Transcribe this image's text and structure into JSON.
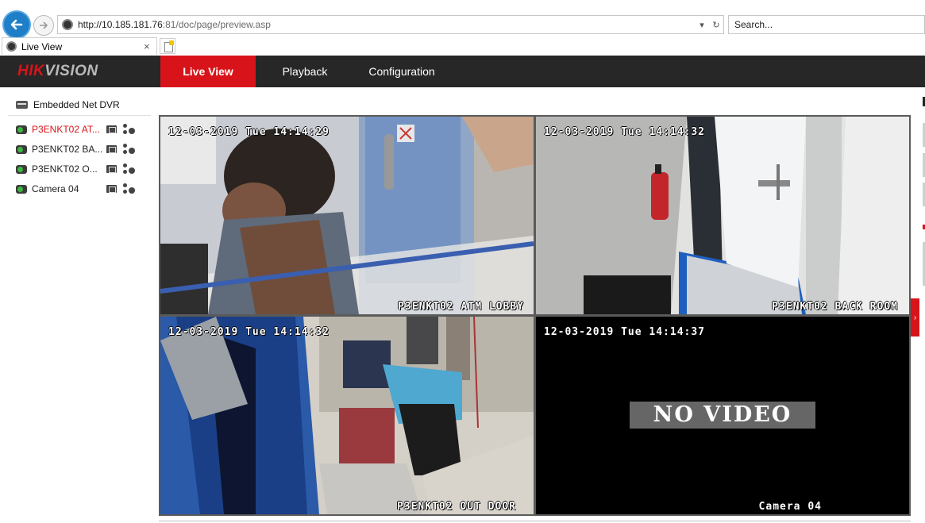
{
  "browser": {
    "url_host": "http://10.185.181.76",
    "url_rest": ":81/doc/page/preview.asp",
    "search_placeholder": "Search...",
    "tab_title": "Live View",
    "tab_close": "×",
    "dropdown_glyph": "▾",
    "refresh_glyph": "↻"
  },
  "app": {
    "logo_red": "HIK",
    "logo_rest": "VISION",
    "menu": [
      {
        "label": "Live View",
        "active": true
      },
      {
        "label": "Playback",
        "active": false
      },
      {
        "label": "Configuration",
        "active": false
      }
    ]
  },
  "sidebar": {
    "device": "Embedded Net DVR",
    "cameras": [
      {
        "label": "P3ENKT02 AT...",
        "active": true
      },
      {
        "label": "P3ENKT02 BA...",
        "active": false
      },
      {
        "label": "P3ENKT02 O...",
        "active": false
      },
      {
        "label": "Camera 04",
        "active": false
      }
    ]
  },
  "tiles": [
    {
      "timestamp": "12-03-2019 Tue 14:14:29",
      "name": "P3ENKT02 ATM LOBBY",
      "no_video": ""
    },
    {
      "timestamp": "12-03-2019 Tue 14:14:32",
      "name": "P3ENKT02 BACK ROOM",
      "no_video": ""
    },
    {
      "timestamp": "12-03-2019 Tue 14:14:32",
      "name": "P3ENKT02 OUT DOOR",
      "no_video": ""
    },
    {
      "timestamp": "12-03-2019 Tue 14:14:37",
      "name": "Camera 04",
      "no_video": "NO VIDEO"
    }
  ],
  "panel_toggle_glyph": "›",
  "colors": {
    "accent_red": "#d8141a",
    "header_bg": "#272727",
    "selected_border": "#e6b800"
  }
}
